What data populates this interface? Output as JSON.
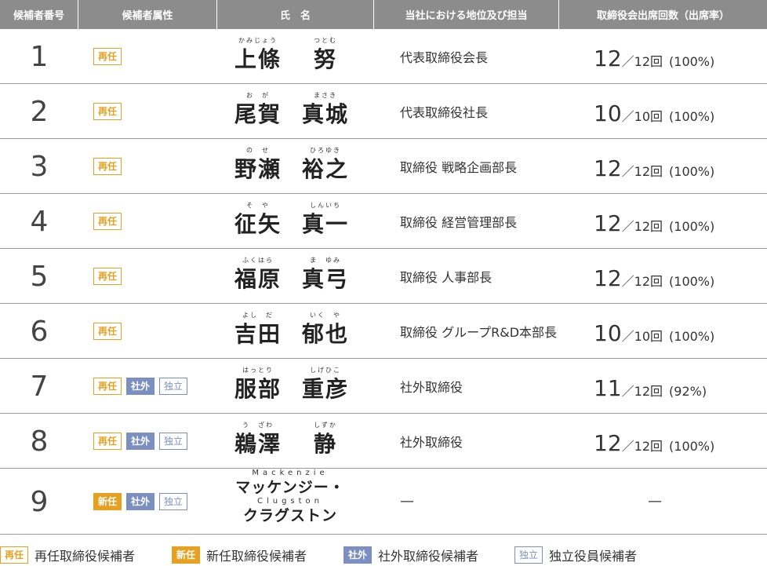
{
  "headers": {
    "number": "候補者番号",
    "attributes": "候補者属性",
    "name": "氏　名",
    "position": "当社における地位及び担当",
    "attendance": "取締役会出席回数（出席率）"
  },
  "badges": {
    "reappoint": "再任",
    "new": "新任",
    "outside": "社外",
    "independent": "独立"
  },
  "candidates": [
    {
      "number": "1",
      "surname": "上條",
      "surname_ruby": "かみじょう",
      "given": "努",
      "given_ruby": "つとむ",
      "position": "代表取締役会長",
      "attended": "12",
      "total": "／12回",
      "rate": "(100%)"
    },
    {
      "number": "2",
      "surname": "尾賀",
      "surname_ruby": "お　が",
      "given": "真城",
      "given_ruby": "まさき",
      "position": "代表取締役社長",
      "attended": "10",
      "total": "／10回",
      "rate": "(100%)"
    },
    {
      "number": "3",
      "surname": "野瀬",
      "surname_ruby": "の　せ",
      "given": "裕之",
      "given_ruby": "ひろゆき",
      "position": "取締役 戦略企画部長",
      "attended": "12",
      "total": "／12回",
      "rate": "(100%)"
    },
    {
      "number": "4",
      "surname": "征矢",
      "surname_ruby": "そ　や",
      "given": "真一",
      "given_ruby": "しんいち",
      "position": "取締役 経営管理部長",
      "attended": "12",
      "total": "／12回",
      "rate": "(100%)"
    },
    {
      "number": "5",
      "surname": "福原",
      "surname_ruby": "ふくはら",
      "given": "真弓",
      "given_ruby": "ま　ゆみ",
      "position": "取締役 人事部長",
      "attended": "12",
      "total": "／12回",
      "rate": "(100%)"
    },
    {
      "number": "6",
      "surname": "吉田",
      "surname_ruby": "よし　だ",
      "given": "郁也",
      "given_ruby": "いく　や",
      "position": "取締役 グループR&D本部長",
      "attended": "10",
      "total": "／10回",
      "rate": "(100%)"
    },
    {
      "number": "7",
      "surname": "服部",
      "surname_ruby": "はっとり",
      "given": "重彦",
      "given_ruby": "しげひこ",
      "position": "社外取締役",
      "attended": "11",
      "total": "／12回",
      "rate": "(92%)"
    },
    {
      "number": "8",
      "surname": "鵜澤",
      "surname_ruby": "う　ざわ",
      "given": "静",
      "given_ruby": "しずか",
      "position": "社外取締役",
      "attended": "12",
      "total": "／12回",
      "rate": "(100%)"
    }
  ],
  "candidate9": {
    "number": "9",
    "ruby_top": "Mackenzie",
    "name_line1": "マッケンジー・",
    "ruby_mid": "Clugston",
    "name_line2": "クラグストン",
    "position": "—",
    "attendance": "—"
  },
  "legend": {
    "reappoint_label": "再任取締役候補者",
    "new_label": "新任取締役候補者",
    "outside_label": "社外取締役候補者",
    "independent_label": "独立役員候補者"
  },
  "colors": {
    "header_bg": "#8c8c8c",
    "reappoint": "#e8a020",
    "outside": "#7b8fc0"
  }
}
